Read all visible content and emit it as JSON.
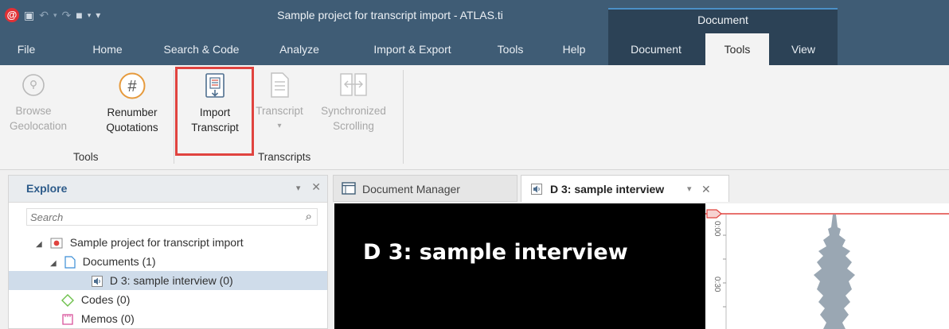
{
  "title_bar": {
    "window_title": "Sample project for transcript import - ATLAS.ti",
    "context_group_label": "Document"
  },
  "ribbon_tabs": [
    {
      "label": "File"
    },
    {
      "label": "Home"
    },
    {
      "label": "Search & Code"
    },
    {
      "label": "Analyze"
    },
    {
      "label": "Import & Export"
    },
    {
      "label": "Tools"
    },
    {
      "label": "Help"
    },
    {
      "label": "Document"
    },
    {
      "label": "Tools",
      "active": true
    },
    {
      "label": "View"
    }
  ],
  "ribbon": {
    "browse_geolocation": {
      "line1": "Browse",
      "line2": "Geolocation"
    },
    "renumber_quotations": {
      "line1": "Renumber",
      "line2": "Quotations"
    },
    "import_transcript": {
      "line1": "Import",
      "line2": "Transcript"
    },
    "transcript": {
      "line1": "Transcript",
      "line2": "▾"
    },
    "synchronized_scrolling": {
      "line1": "Synchronized",
      "line2": "Scrolling"
    },
    "groups": {
      "tools": "Tools",
      "transcripts": "Transcripts"
    }
  },
  "explore": {
    "title": "Explore",
    "search_placeholder": "Search",
    "tree": [
      {
        "label": "Sample project for transcript import"
      },
      {
        "label": "Documents (1)"
      },
      {
        "label": "D 3: sample interview (0)"
      },
      {
        "label": "Codes (0)"
      },
      {
        "label": "Memos (0)"
      }
    ]
  },
  "doc_tabs": {
    "manager": "Document Manager",
    "active": "D 3: sample interview"
  },
  "document": {
    "heading": "D 3: sample interview",
    "timeline_marks": [
      "0:00",
      "0:30"
    ]
  },
  "colors": {
    "titlebar": "#3f5c75",
    "context_tab": "#2c4256",
    "highlight": "#e0433f",
    "selection": "#cfdcea"
  }
}
